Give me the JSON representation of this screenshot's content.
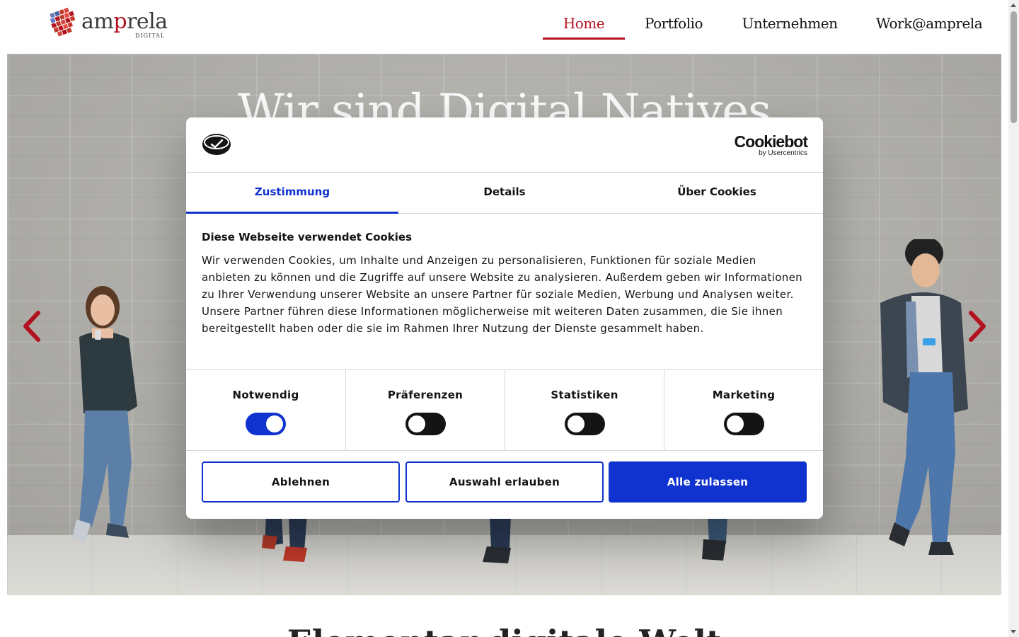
{
  "header": {
    "logo_word_start": "am",
    "logo_word_accent": "p",
    "logo_word_end": "rela",
    "logo_sub": "DIGITAL",
    "nav": [
      {
        "label": "Home",
        "active": true
      },
      {
        "label": "Portfolio",
        "active": false
      },
      {
        "label": "Unternehmen",
        "active": false
      },
      {
        "label": "Work@amprela",
        "active": false
      }
    ]
  },
  "hero": {
    "title": "Wir sind Digital Natives",
    "prev_icon": "chevron-left-icon",
    "next_icon": "chevron-right-icon"
  },
  "below": {
    "heading": "Elementar digitale Welt"
  },
  "cookie_dialog": {
    "brand_name": "Cookiebot",
    "brand_by": "by Usercentrics",
    "tabs": [
      {
        "label": "Zustimmung",
        "active": true
      },
      {
        "label": "Details",
        "active": false
      },
      {
        "label": "Über Cookies",
        "active": false
      }
    ],
    "heading": "Diese Webseite verwendet Cookies",
    "text": "Wir verwenden Cookies, um Inhalte und Anzeigen zu personalisieren, Funktionen für soziale Medien anbieten zu können und die Zugriffe auf unsere Website zu analysieren. Außerdem geben wir Informationen zu Ihrer Verwendung unserer Website an unsere Partner für soziale Medien, Werbung und Analysen weiter. Unsere Partner führen diese Informationen möglicherweise mit weiteren Daten zusammen, die Sie ihnen bereitgestellt haben oder die sie im Rahmen Ihrer Nutzung der Dienste gesammelt haben.",
    "categories": [
      {
        "label": "Notwendig",
        "enabled": true
      },
      {
        "label": "Präferenzen",
        "enabled": false
      },
      {
        "label": "Statistiken",
        "enabled": false
      },
      {
        "label": "Marketing",
        "enabled": false
      }
    ],
    "buttons": {
      "decline": "Ablehnen",
      "allow_selection": "Auswahl erlauben",
      "allow_all": "Alle zulassen"
    }
  },
  "colors": {
    "brand_red": "#b3121f",
    "cookiebot_blue": "#1032cf",
    "text_dark": "#141414"
  }
}
